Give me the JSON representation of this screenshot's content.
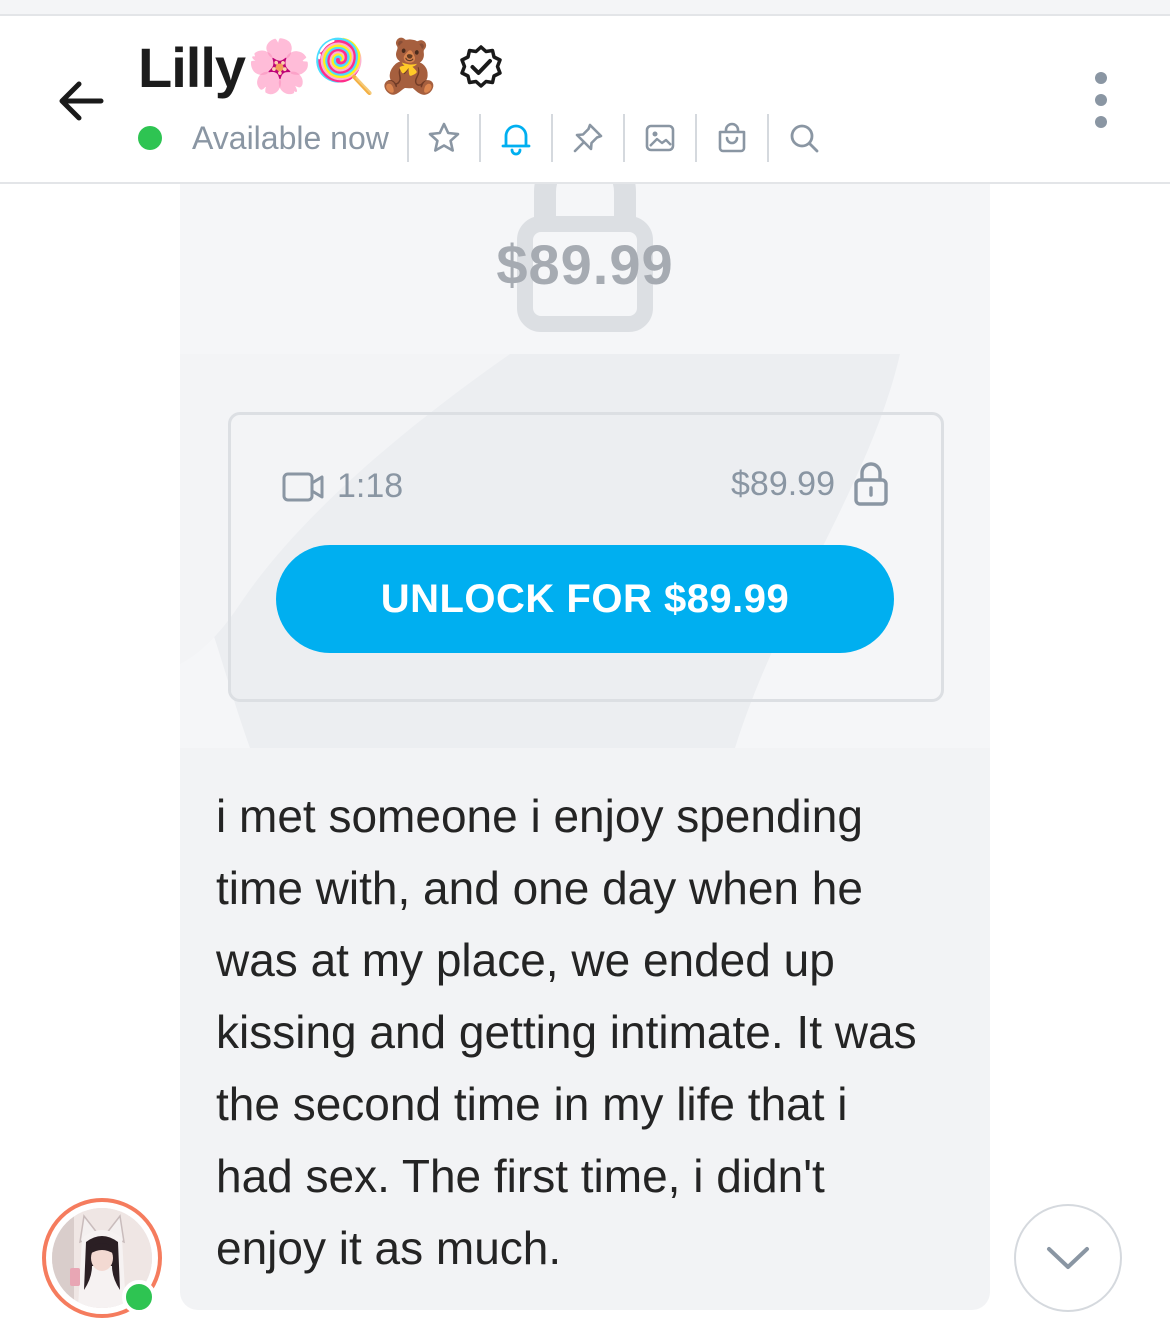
{
  "header": {
    "name": "Lilly",
    "name_emojis": "🌸🍭🧸",
    "status": "Available now",
    "toolbar_icons": [
      "star-icon",
      "bell-icon",
      "pin-icon",
      "image-icon",
      "shopping-bag-icon",
      "search-icon"
    ]
  },
  "message": {
    "media": {
      "watermark_price": "$89.99",
      "duration": "1:18",
      "price": "$89.99",
      "unlock_label": "UNLOCK FOR $89.99"
    },
    "text": "i met someone i enjoy spending time with, and one day when he was at my place, we ended up kissing and getting intimate. It was the second time in my life that i had sex. The first time, i didn't enjoy it as much."
  },
  "colors": {
    "accent": "#00aff0",
    "online": "#2ec452",
    "muted": "#8a96a3",
    "avatar_ring": "#f57c5e"
  }
}
